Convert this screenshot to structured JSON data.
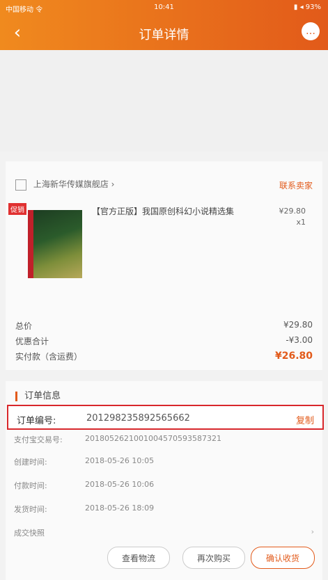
{
  "statusbar": {
    "carrier": "中国移动 令",
    "time": "10:41",
    "battery": "▮ ◂ 93%"
  },
  "nav": {
    "back_icon": "‹",
    "title": "订单详情",
    "message_icon": "…"
  },
  "order": {
    "store": "上海新华传媒旗舰店 ›",
    "contact": "联系卖家",
    "goods": {
      "tag": "促销",
      "name": "【官方正版】我国原创科幻小说精选集",
      "price": "¥29.80",
      "qty": "x1"
    },
    "summary": [
      {
        "label": "总价",
        "value": "¥29.80"
      },
      {
        "label": "优惠合计",
        "value": "-¥3.00"
      },
      {
        "label": "实付款（含运费）",
        "value": "¥26.80"
      }
    ]
  },
  "info": {
    "title": "订单信息",
    "order_no_label": "订单编号:",
    "order_no": "201298235892565662",
    "copy": "复制",
    "rows": [
      {
        "k": "支付宝交易号:",
        "v": "2018052621001004570593587321"
      },
      {
        "k": "创建时间:",
        "v": "2018-05-26 10:05"
      },
      {
        "k": "付款时间:",
        "v": "2018-05-26 10:06"
      },
      {
        "k": "发货时间:",
        "v": "2018-05-26 18:09"
      },
      {
        "k": "成交快照",
        "v": "",
        "arrow": "›"
      }
    ],
    "buttons": [
      "查看物流",
      "再次购买",
      "确认收货"
    ]
  }
}
